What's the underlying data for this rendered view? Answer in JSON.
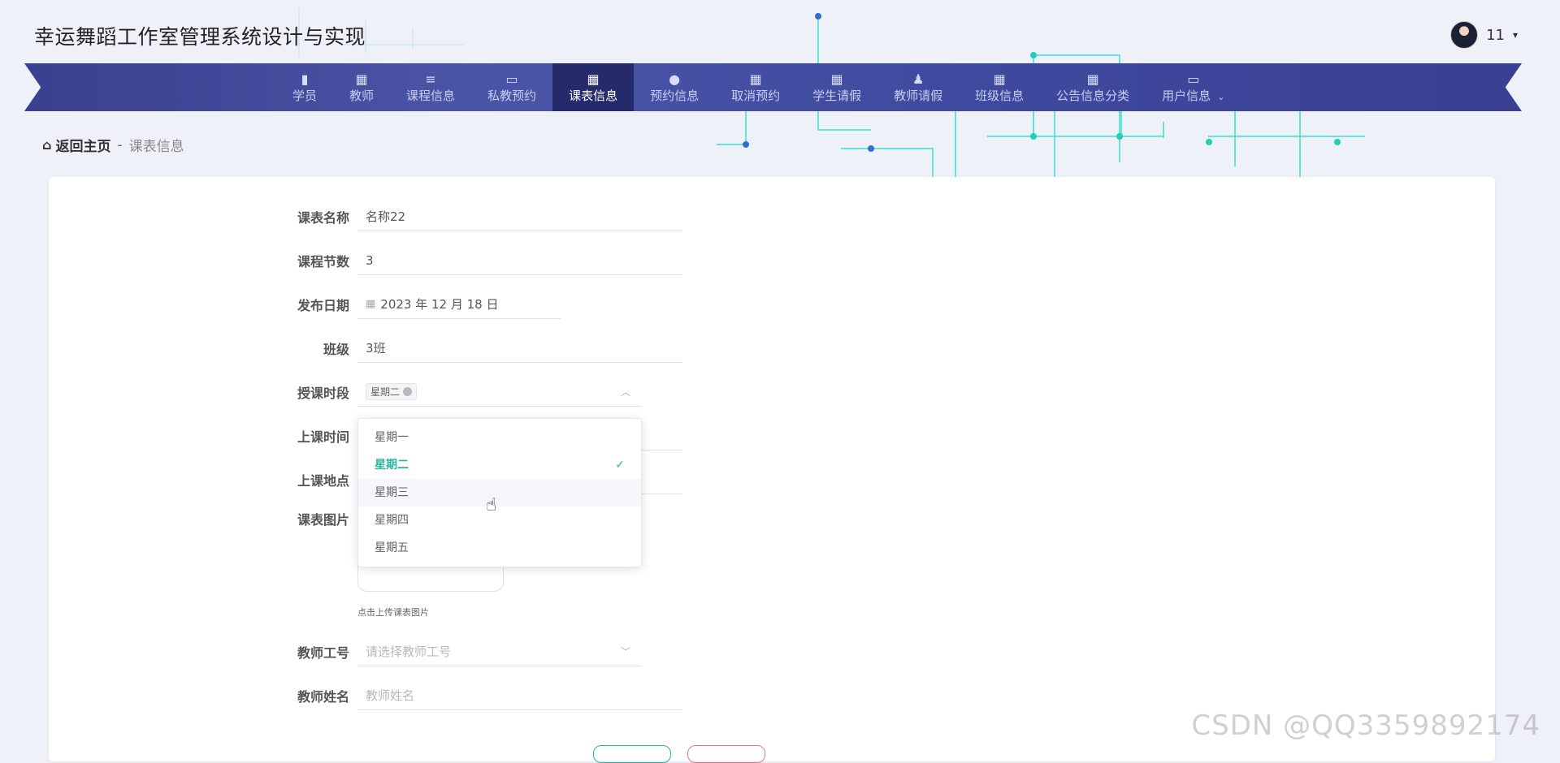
{
  "header": {
    "app_title": "幸运舞蹈工作室管理系统设计与实现",
    "user_name": "11",
    "caret": "▾"
  },
  "nav": {
    "items": [
      {
        "label": "学员",
        "icon": "bar-chart-icon",
        "glyph": "▮"
      },
      {
        "label": "教师",
        "icon": "grid-icon",
        "glyph": "▦"
      },
      {
        "label": "课程信息",
        "icon": "list-icon",
        "glyph": "≡"
      },
      {
        "label": "私教预约",
        "icon": "monitor-icon",
        "glyph": "▭"
      },
      {
        "label": "课表信息",
        "icon": "grid-icon",
        "glyph": "▦",
        "active": true
      },
      {
        "label": "预约信息",
        "icon": "bulb-icon",
        "glyph": "●"
      },
      {
        "label": "取消预约",
        "icon": "grid-icon",
        "glyph": "▦"
      },
      {
        "label": "学生请假",
        "icon": "grid-icon",
        "glyph": "▦"
      },
      {
        "label": "教师请假",
        "icon": "person-icon",
        "glyph": "♟"
      },
      {
        "label": "班级信息",
        "icon": "grid-icon",
        "glyph": "▦"
      },
      {
        "label": "公告信息分类",
        "icon": "grid-icon",
        "glyph": "▦"
      },
      {
        "label": "用户信息",
        "icon": "card-icon",
        "glyph": "▭",
        "submenu": "⌄"
      }
    ]
  },
  "breadcrumb": {
    "home": "返回主页",
    "separator": "-",
    "current": "课表信息"
  },
  "form": {
    "name": {
      "label": "课表名称",
      "value": "名称22"
    },
    "sessions": {
      "label": "课程节数",
      "value": "3"
    },
    "publish_date": {
      "label": "发布日期",
      "value": "2023 年 12 月 18 日"
    },
    "class": {
      "label": "班级",
      "value": "3班"
    },
    "period": {
      "label": "授课时段",
      "tag": "星期二"
    },
    "class_time": {
      "label": "上课时间"
    },
    "location": {
      "label": "上课地点"
    },
    "image": {
      "label": "课表图片",
      "hint": "点击上传课表图片"
    },
    "teacher_id": {
      "label": "教师工号",
      "placeholder": "请选择教师工号"
    },
    "teacher_name": {
      "label": "教师姓名",
      "placeholder": "教师姓名"
    }
  },
  "dropdown": {
    "options": [
      {
        "label": "星期一"
      },
      {
        "label": "星期二",
        "selected": true
      },
      {
        "label": "星期三",
        "hover": true
      },
      {
        "label": "星期四"
      },
      {
        "label": "星期五"
      }
    ],
    "check": "✓"
  },
  "watermark": "CSDN @QQ3359892174",
  "colors": {
    "nav": "#3f4ba0",
    "nav_active": "#252a6b",
    "accent": "#2ab6a1",
    "circuit": "#3de0d0"
  }
}
